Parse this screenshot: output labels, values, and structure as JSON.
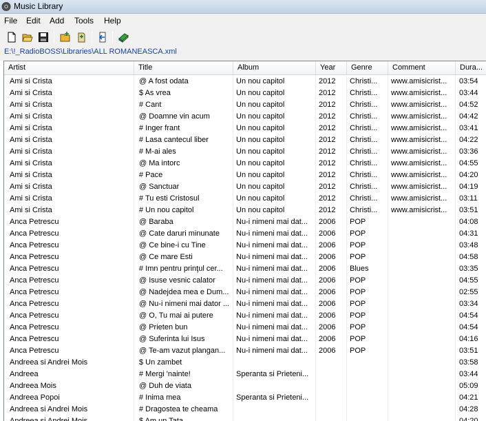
{
  "window": {
    "title": "Music Library"
  },
  "menu": [
    "File",
    "Edit",
    "Add",
    "Tools",
    "Help"
  ],
  "toolbar": {
    "buttons": [
      {
        "icon": "new-file-icon"
      },
      {
        "icon": "open-folder-icon"
      },
      {
        "icon": "save-icon"
      },
      {
        "icon": "add-folder-icon"
      },
      {
        "icon": "add-file-icon"
      },
      {
        "icon": "import-icon"
      },
      {
        "icon": "library-icon"
      }
    ]
  },
  "library_path": "E:\\!_RadioBOSS\\Libraries\\ALL ROMANEASCA.xml",
  "columns": [
    "Artist",
    "Title",
    "Album",
    "Year",
    "Genre",
    "Comment",
    "Dura..."
  ],
  "rows": [
    {
      "artist": "Ami si Crista",
      "title": "@ A fost odata",
      "album": "Un nou capitol",
      "year": "2012",
      "genre": "Christi...",
      "comment": "www.amisicrist...",
      "duration": "03:54"
    },
    {
      "artist": "Ami si Crista",
      "title": "$ As vrea",
      "album": "Un nou capitol",
      "year": "2012",
      "genre": "Christi...",
      "comment": "www.amisicrist...",
      "duration": "03:44"
    },
    {
      "artist": "Ami si Crista",
      "title": "# Cant",
      "album": "Un nou capitol",
      "year": "2012",
      "genre": "Christi...",
      "comment": "www.amisicrist...",
      "duration": "04:52"
    },
    {
      "artist": "Ami si Crista",
      "title": "@ Doamne vin acum",
      "album": "Un nou capitol",
      "year": "2012",
      "genre": "Christi...",
      "comment": "www.amisicrist...",
      "duration": "04:42"
    },
    {
      "artist": "Ami si Crista",
      "title": "# Inger frant",
      "album": "Un nou capitol",
      "year": "2012",
      "genre": "Christi...",
      "comment": "www.amisicrist...",
      "duration": "03:41"
    },
    {
      "artist": "Ami si Crista",
      "title": "# Lasa cantecul liber",
      "album": "Un nou capitol",
      "year": "2012",
      "genre": "Christi...",
      "comment": "www.amisicrist...",
      "duration": "04:22"
    },
    {
      "artist": "Ami si Crista",
      "title": "# M-ai ales",
      "album": "Un nou capitol",
      "year": "2012",
      "genre": "Christi...",
      "comment": "www.amisicrist...",
      "duration": "03:36"
    },
    {
      "artist": "Ami si Crista",
      "title": "@ Ma intorc",
      "album": "Un nou capitol",
      "year": "2012",
      "genre": "Christi...",
      "comment": "www.amisicrist...",
      "duration": "04:55"
    },
    {
      "artist": "Ami si Crista",
      "title": "# Pace",
      "album": "Un nou capitol",
      "year": "2012",
      "genre": "Christi...",
      "comment": "www.amisicrist...",
      "duration": "04:20"
    },
    {
      "artist": "Ami si Crista",
      "title": "@ Sanctuar",
      "album": "Un nou capitol",
      "year": "2012",
      "genre": "Christi...",
      "comment": "www.amisicrist...",
      "duration": "04:19"
    },
    {
      "artist": "Ami si Crista",
      "title": "# Tu esti Cristosul",
      "album": "Un nou capitol",
      "year": "2012",
      "genre": "Christi...",
      "comment": "www.amisicrist...",
      "duration": "03:11"
    },
    {
      "artist": "Ami si Crista",
      "title": "# Un nou capitol",
      "album": "Un nou capitol",
      "year": "2012",
      "genre": "Christi...",
      "comment": "www.amisicrist...",
      "duration": "03:51"
    },
    {
      "artist": "Anca Petrescu",
      "title": "@ Baraba",
      "album": "Nu-i nimeni mai dat...",
      "year": "2006",
      "genre": "POP",
      "comment": "",
      "duration": "04:08"
    },
    {
      "artist": "Anca Petrescu",
      "title": "@ Cate daruri minunate",
      "album": "Nu-i nimeni mai dat...",
      "year": "2006",
      "genre": "POP",
      "comment": "",
      "duration": "04:31"
    },
    {
      "artist": "Anca Petrescu",
      "title": "@ Ce bine-i cu Tine",
      "album": "Nu-i nimeni mai dat...",
      "year": "2006",
      "genre": "POP",
      "comment": "",
      "duration": "03:48"
    },
    {
      "artist": "Anca Petrescu",
      "title": "@ Ce mare Esti",
      "album": "Nu-i nimeni mai dat...",
      "year": "2006",
      "genre": "POP",
      "comment": "",
      "duration": "04:58"
    },
    {
      "artist": "Anca Petrescu",
      "title": "# Imn pentru prinţul cer...",
      "album": "Nu-i nimeni mai dat...",
      "year": "2006",
      "genre": "Blues",
      "comment": "",
      "duration": "03:35"
    },
    {
      "artist": "Anca Petrescu",
      "title": "@ Isuse vesnic calator",
      "album": "Nu-i nimeni mai dat...",
      "year": "2006",
      "genre": "POP",
      "comment": "",
      "duration": "04:55"
    },
    {
      "artist": "Anca Petrescu",
      "title": "@ Nadejdea mea e Dum...",
      "album": "Nu-i nimeni mai dat...",
      "year": "2006",
      "genre": "POP",
      "comment": "",
      "duration": "02:55"
    },
    {
      "artist": "Anca Petrescu",
      "title": "@ Nu-i nimeni mai dator ...",
      "album": "Nu-i nimeni mai dat...",
      "year": "2006",
      "genre": "POP",
      "comment": "",
      "duration": "03:34"
    },
    {
      "artist": "Anca Petrescu",
      "title": "@ O, Tu mai ai putere",
      "album": "Nu-i nimeni mai dat...",
      "year": "2006",
      "genre": "POP",
      "comment": "",
      "duration": "04:54"
    },
    {
      "artist": "Anca Petrescu",
      "title": "@ Prieten bun",
      "album": "Nu-i nimeni mai dat...",
      "year": "2006",
      "genre": "POP",
      "comment": "",
      "duration": "04:54"
    },
    {
      "artist": "Anca Petrescu",
      "title": "@ Suferinta lui Isus",
      "album": "Nu-i nimeni mai dat...",
      "year": "2006",
      "genre": "POP",
      "comment": "",
      "duration": "04:16"
    },
    {
      "artist": "Anca Petrescu",
      "title": "@ Te-am vazut plangan...",
      "album": "Nu-i nimeni mai dat...",
      "year": "2006",
      "genre": "POP",
      "comment": "",
      "duration": "03:51"
    },
    {
      "artist": "Andreea si Andrei Mois",
      "title": "$ Un zambet",
      "album": "",
      "year": "",
      "genre": "",
      "comment": "",
      "duration": "03:58"
    },
    {
      "artist": "Andreea",
      "title": "# Mergi 'nainte!",
      "album": "Speranta si Prieteni...",
      "year": "",
      "genre": "",
      "comment": "",
      "duration": "03:44"
    },
    {
      "artist": "Andreea  Mois",
      "title": "@ Duh de viata",
      "album": "",
      "year": "",
      "genre": "",
      "comment": "",
      "duration": "05:09"
    },
    {
      "artist": "Andreea Popoi",
      "title": "# Inima mea",
      "album": "Speranta si Prieteni...",
      "year": "",
      "genre": "",
      "comment": "",
      "duration": "04:21"
    },
    {
      "artist": "Andreea si Andrei Mois",
      "title": "# Dragostea te cheama",
      "album": "",
      "year": "",
      "genre": "",
      "comment": "",
      "duration": "04:28"
    },
    {
      "artist": "Andreea si Andrei Mois",
      "title": "$ Am un Tata",
      "album": "",
      "year": "",
      "genre": "",
      "comment": "",
      "duration": "04:20"
    }
  ]
}
